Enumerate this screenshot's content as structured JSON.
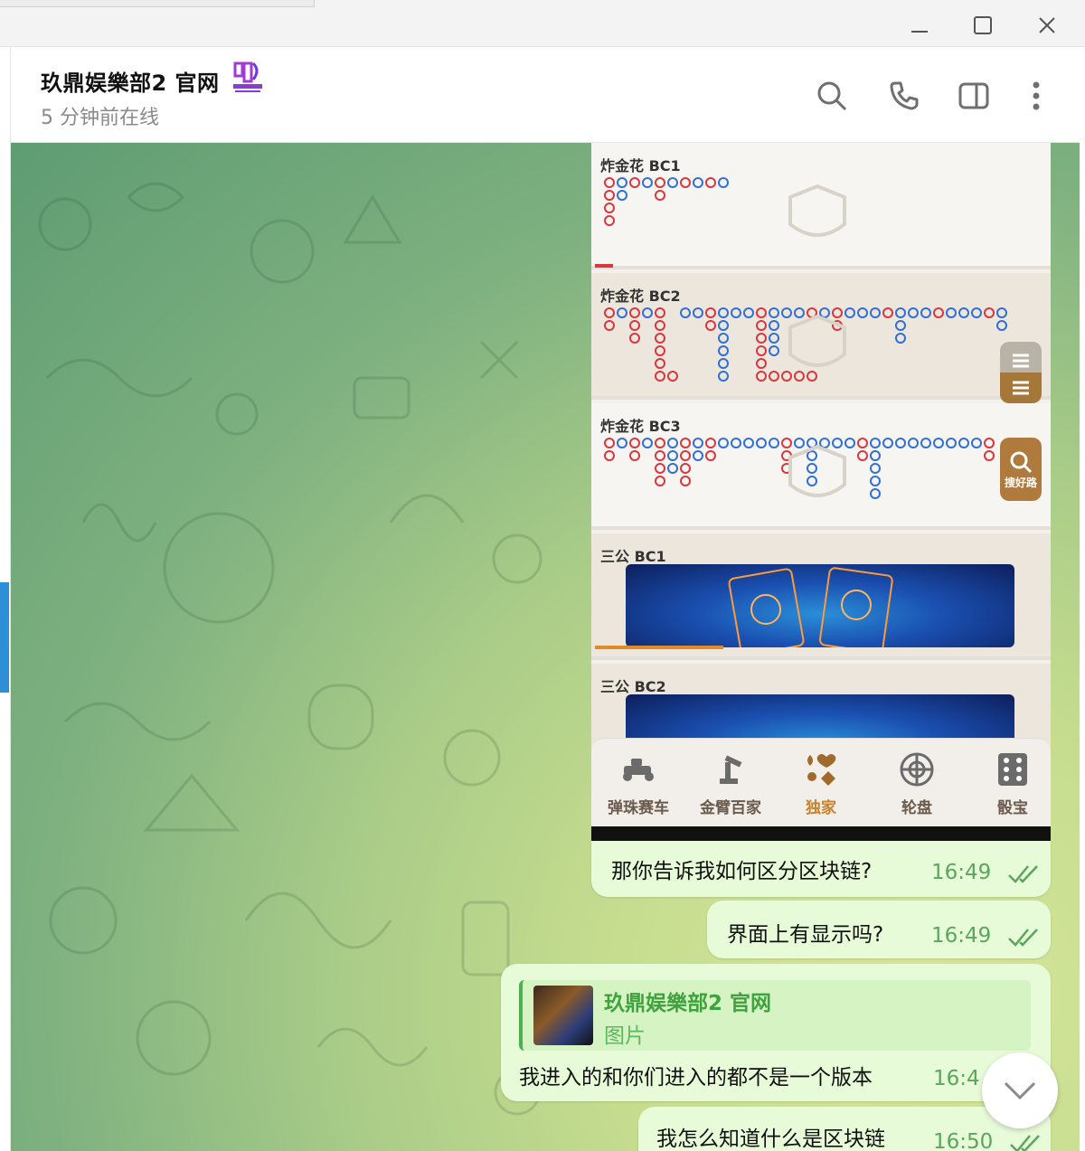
{
  "window": {
    "controls": [
      "minimize-icon",
      "maximize-icon",
      "close-icon"
    ]
  },
  "header": {
    "title": "玖鼎娱樂部2 官网",
    "status": "5 分钟前在线",
    "icons": [
      "search-icon",
      "phone-icon",
      "sidebar-toggle-icon",
      "more-vertical-icon"
    ]
  },
  "game_panel": {
    "roads": [
      {
        "title": "炸金花 BC1"
      },
      {
        "title": "炸金花 BC2"
      },
      {
        "title": "炸金花 BC3"
      }
    ],
    "sangong": [
      {
        "title": "三公 BC1"
      },
      {
        "title": "三公 BC2"
      }
    ],
    "search_button_label": "搜好路",
    "tabs": [
      {
        "label": "弹珠赛车",
        "icon": "race-car-icon"
      },
      {
        "label": "金臂百家",
        "icon": "robot-arm-icon"
      },
      {
        "label": "独家",
        "icon": "card-suits-icon",
        "active": true
      },
      {
        "label": "轮盘",
        "icon": "roulette-icon"
      },
      {
        "label": "骰宝",
        "icon": "dice-icon"
      }
    ]
  },
  "messages": [
    {
      "text": "那你告诉我如何区分区块链?",
      "time": "16:49",
      "status": "read"
    },
    {
      "text": "界面上有显示吗?",
      "time": "16:49",
      "status": "read"
    },
    {
      "reply_to": {
        "name": "玖鼎娱樂部2 官网",
        "preview": "图片"
      },
      "text": "我进入的和你们进入的都不是一个版本",
      "time": "16:4"
    },
    {
      "text": "我怎么知道什么是区块链",
      "time": "16:50",
      "status": "read"
    }
  ],
  "colors": {
    "accent_green": "#5aa65a",
    "bubble_bg": "#e8fbd9",
    "tab_active": "#c8822a",
    "road_red": "#d9363e",
    "road_blue": "#2f6fd6"
  }
}
